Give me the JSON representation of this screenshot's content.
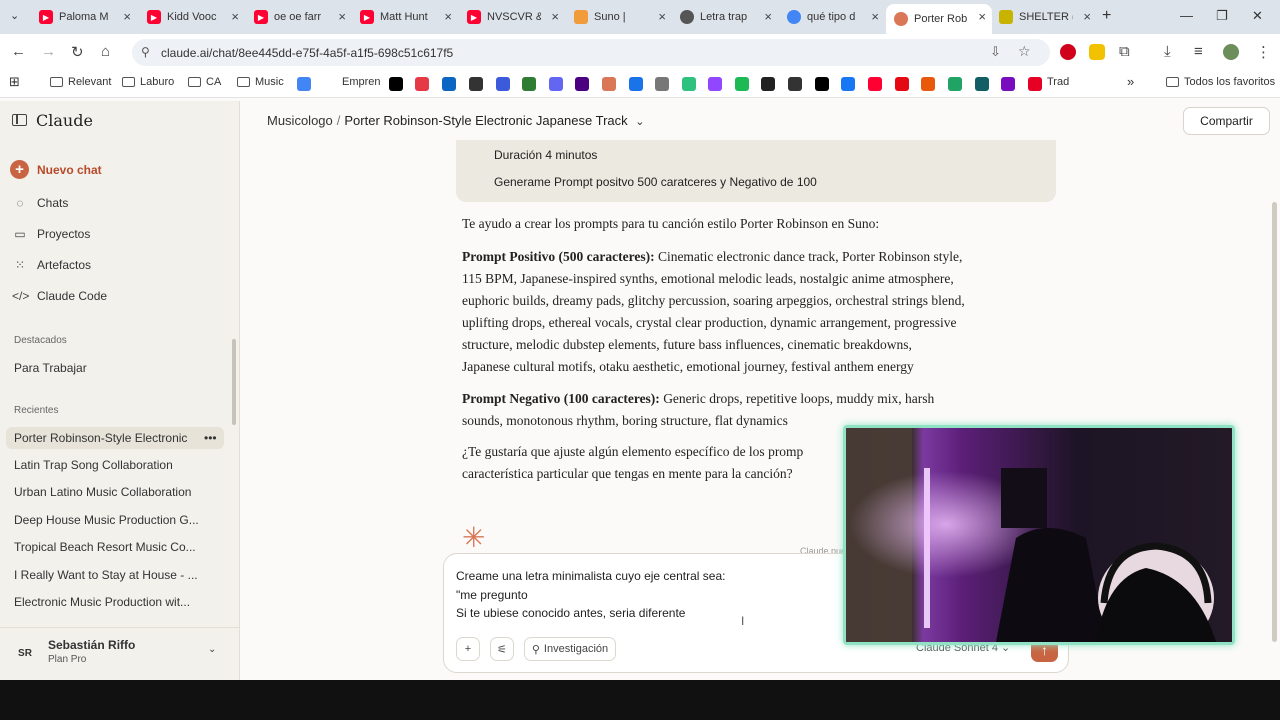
{
  "browser": {
    "tabs": [
      {
        "title": "Paloma M",
        "fav_color": "#ff0033",
        "fav": "yt"
      },
      {
        "title": "Kidd Vooc",
        "fav_color": "#ff0033",
        "fav": "yt"
      },
      {
        "title": "oe oe farr",
        "fav_color": "#ff0033",
        "fav": "yt"
      },
      {
        "title": "Matt Hunt",
        "fav_color": "#ff0033",
        "fav": "yt"
      },
      {
        "title": "NVSCVR &",
        "fav_color": "#ff0033",
        "fav": "yt"
      },
      {
        "title": "Suno |",
        "fav_color": "#f29b3a",
        "fav": "suno"
      },
      {
        "title": "Letra trap",
        "fav_color": "#555555",
        "fav": "openai"
      },
      {
        "title": "qué tipo d",
        "fav_color": "#4285f4",
        "fav": "google"
      },
      {
        "title": "Porter Rob",
        "fav_color": "#d97757",
        "fav": "claude"
      },
      {
        "title": "SHELTER (",
        "fav_color": "#c8b400",
        "fav": "shelter"
      }
    ],
    "url": "claude.ai/chat/8ee445dd-e75f-4a5f-a1f5-698c51c617f5",
    "bookmarks": {
      "relevant": "Relevant",
      "laburo": "Laburo",
      "ca": "CA",
      "music": "Music",
      "emprendimiento": "Empren",
      "trad": "Trad",
      "all": "Todos los favoritos"
    },
    "bookmark_icon_colors": [
      "#4285f4",
      "#000000",
      "#e63946",
      "#0a66c2",
      "#333333",
      "#3b5bdb",
      "#2e7d32",
      "#6366f1",
      "#4b0082",
      "#d97757",
      "#1a73e8",
      "#777777",
      "#2ec27e",
      "#9146ff",
      "#1db954",
      "#222222",
      "#333333",
      "#000000",
      "#1877f2",
      "#ff0033",
      "#e50914",
      "#e8590c",
      "#21a366",
      "#115e67",
      "#780dbd",
      "#e60023",
      "#4285f4"
    ]
  },
  "sidebar": {
    "brand": "Claude",
    "new_chat": "Nuevo chat",
    "nav": [
      {
        "label": "Chats",
        "icon": "chat-bubble-icon"
      },
      {
        "label": "Proyectos",
        "icon": "projects-icon"
      },
      {
        "label": "Artefactos",
        "icon": "artifacts-icon"
      },
      {
        "label": "Claude Code",
        "icon": "code-icon"
      }
    ],
    "starred_heading": "Destacados",
    "starred": [
      "Para Trabajar"
    ],
    "recent_heading": "Recientes",
    "recents": [
      "Porter Robinson-Style Electronic",
      "Latin Trap Song Collaboration",
      "Urban Latino Music Collaboration",
      "Deep House Music Production G...",
      "Tropical Beach Resort Music Co...",
      "I Really Want to Stay at House - ...",
      "Electronic Music Production wit..."
    ],
    "user": {
      "initials": "SR",
      "name": "Sebastián Riffo",
      "plan": "Plan Pro"
    }
  },
  "header": {
    "project": "Musicologo",
    "separator": "/",
    "chat_title": "Porter Robinson-Style Electronic Japanese Track",
    "share": "Compartir"
  },
  "chat": {
    "user_lines": [
      "Duración 4 minutos",
      "Generame Prompt positvo 500 caratceres y Negativo de 100"
    ],
    "intro": "Te ayudo a crear los prompts para tu canción estilo Porter Robinson en Suno:",
    "pos_label": "Prompt Positivo (500 caracteres):",
    "pos_lines": [
      "Cinematic electronic dance track, Porter Robinson style,",
      "115 BPM, Japanese-inspired synths, emotional melodic leads, nostalgic anime atmosphere,",
      "euphoric builds, dreamy pads, glitchy percussion, soaring arpeggios, orchestral strings blend,",
      "uplifting drops, ethereal vocals, crystal clear production, dynamic arrangement, progressive",
      "structure, melodic dubstep elements, future bass influences, cinematic breakdowns,",
      "Japanese cultural motifs, otaku aesthetic, emotional journey, festival anthem energy"
    ],
    "neg_label": "Prompt Negativo (100 caracteres):",
    "neg_lines": [
      "Generic drops, repetitive loops, muddy mix, harsh",
      "sounds, monotonous rhythm, boring structure, flat dynamics"
    ],
    "question_lines": [
      "¿Te gustaría que ajuste algún elemento específico de los promp",
      "característica particular que tengas en mente para la canción?"
    ],
    "model_hint": "Claude pue"
  },
  "composer": {
    "lines": [
      "Creame una letra minimalista cuyo eje central sea:",
      "\"me pregunto",
      "Si te ubiese conocido antes, seria diferente"
    ],
    "research": "Investigación",
    "model": "Claude Sonnet 4"
  },
  "colors": {
    "accent": "#c96442",
    "spark": "#d97757",
    "webcam_border": "#8fe3c4"
  }
}
